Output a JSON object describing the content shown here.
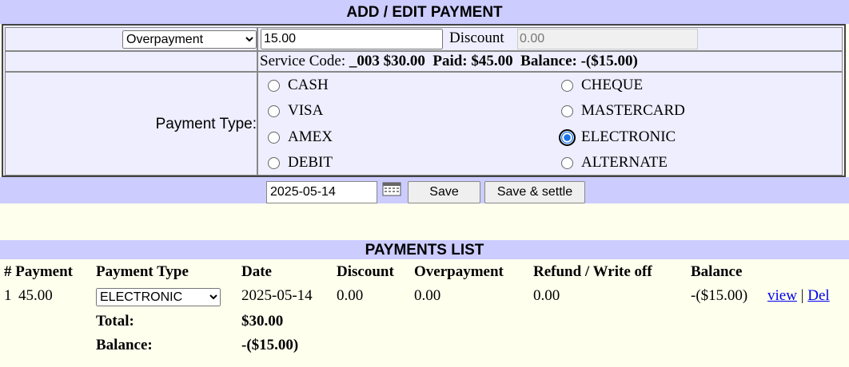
{
  "form": {
    "title": "ADD / EDIT PAYMENT",
    "mode_select": "Overpayment",
    "amount": "15.00",
    "discount_label": "Discount",
    "discount_value": "0.00",
    "service_label": "Service Code:",
    "service_value": "_003 $30.00",
    "paid_label": "Paid:",
    "paid_value": "$45.00",
    "balance_label": "Balance:",
    "balance_value": "-($15.00)",
    "payment_type_label": "Payment Type:",
    "payment_types": [
      "CASH",
      "CHEQUE",
      "VISA",
      "MASTERCARD",
      "AMEX",
      "ELECTRONIC",
      "DEBIT",
      "ALTERNATE"
    ],
    "selected_payment_type": "ELECTRONIC",
    "date": "2025-05-14",
    "save_label": "Save",
    "save_settle_label": "Save & settle"
  },
  "list": {
    "title": "PAYMENTS LIST",
    "headers": [
      "# Payment",
      "Payment Type",
      "Date",
      "Discount",
      "Overpayment",
      "Refund / Write off",
      "Balance"
    ],
    "rows": [
      {
        "num": "1",
        "payment": "45.00",
        "payment_type": "ELECTRONIC",
        "date": "2025-05-14",
        "discount": "0.00",
        "overpayment": "0.00",
        "refund": "0.00",
        "balance": "-($15.00)",
        "view_label": "view",
        "sep": "|",
        "del_label": "Del"
      }
    ],
    "total_label": "Total:",
    "total_value": "$30.00",
    "balance_label": "Balance:",
    "balance_value": "-($15.00)"
  }
}
